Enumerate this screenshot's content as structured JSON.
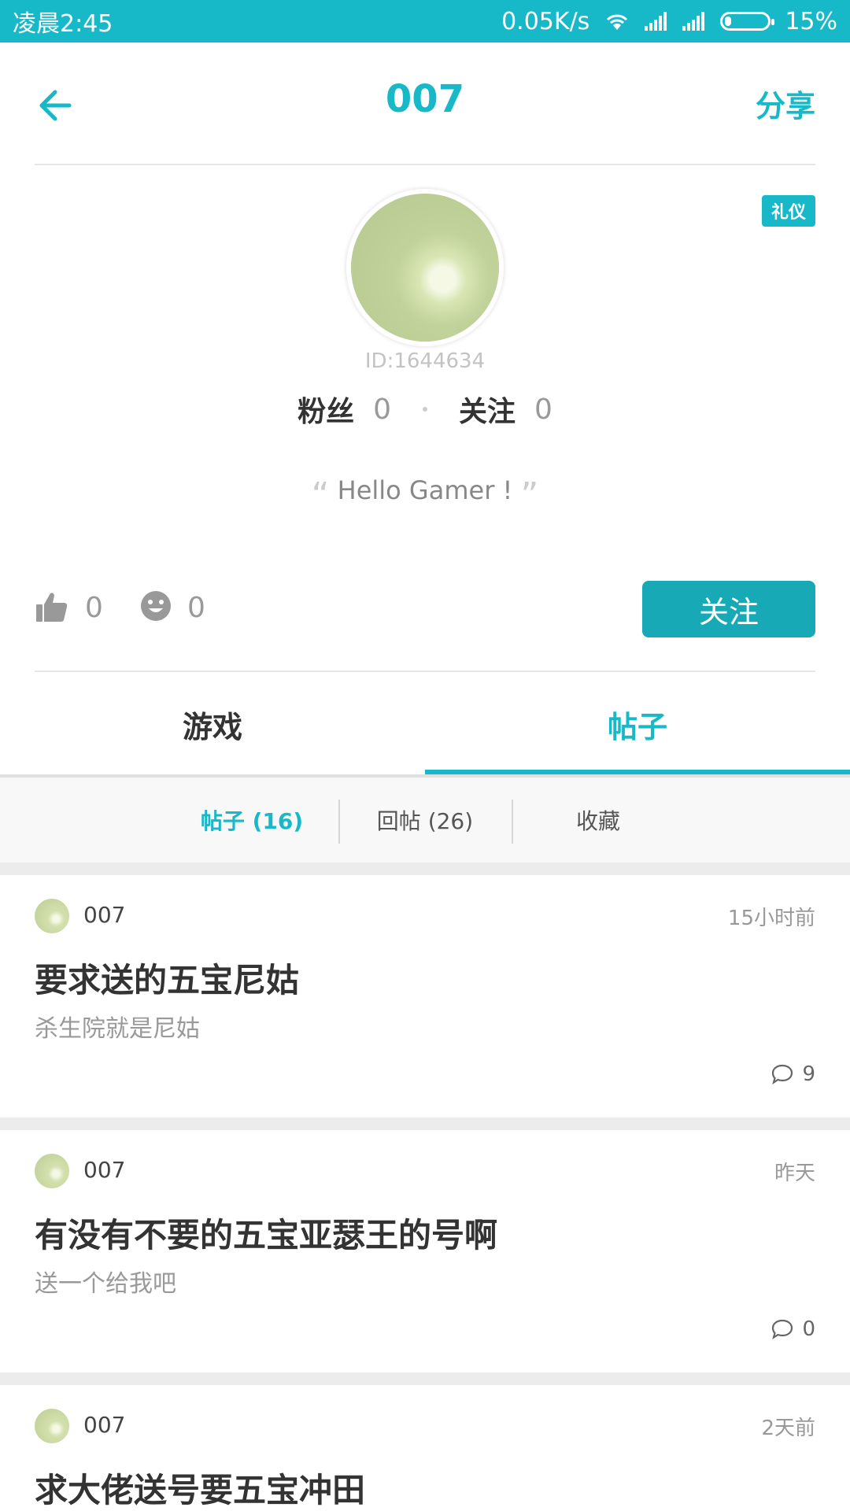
{
  "status_bar": {
    "time": "凌晨2:45",
    "net_speed": "0.05K/s",
    "battery": "15%",
    "battery_level": 0.15
  },
  "header": {
    "back_icon": "back-arrow-icon",
    "title": "007",
    "share_label": "分享"
  },
  "profile": {
    "badge": "礼仪",
    "id": "ID:1644634",
    "fans_label": "粉丝",
    "fans_count": "0",
    "following_label": "关注",
    "following_count": "0",
    "signature": "Hello Gamer !",
    "likes": "0",
    "smiles": "0",
    "follow_button": "关注"
  },
  "tabs": [
    {
      "label": "游戏",
      "active": false
    },
    {
      "label": "帖子",
      "active": true
    }
  ],
  "subtabs": [
    {
      "label": "帖子 (16)",
      "active": true
    },
    {
      "label": "回帖 (26)",
      "active": false
    },
    {
      "label": "收藏",
      "active": false
    }
  ],
  "posts": [
    {
      "author": "007",
      "time": "15小时前",
      "title": "要求送的五宝尼姑",
      "excerpt": "杀生院就是尼姑",
      "comments": "9"
    },
    {
      "author": "007",
      "time": "昨天",
      "title": "有没有不要的五宝亚瑟王的号啊",
      "excerpt": "送一个给我吧",
      "comments": "0"
    },
    {
      "author": "007",
      "time": "2天前",
      "title": "求大佬送号要五宝冲田",
      "excerpt": "",
      "comments": ""
    }
  ],
  "colors": {
    "accent": "#17b8c8",
    "button": "#17a9b6"
  }
}
